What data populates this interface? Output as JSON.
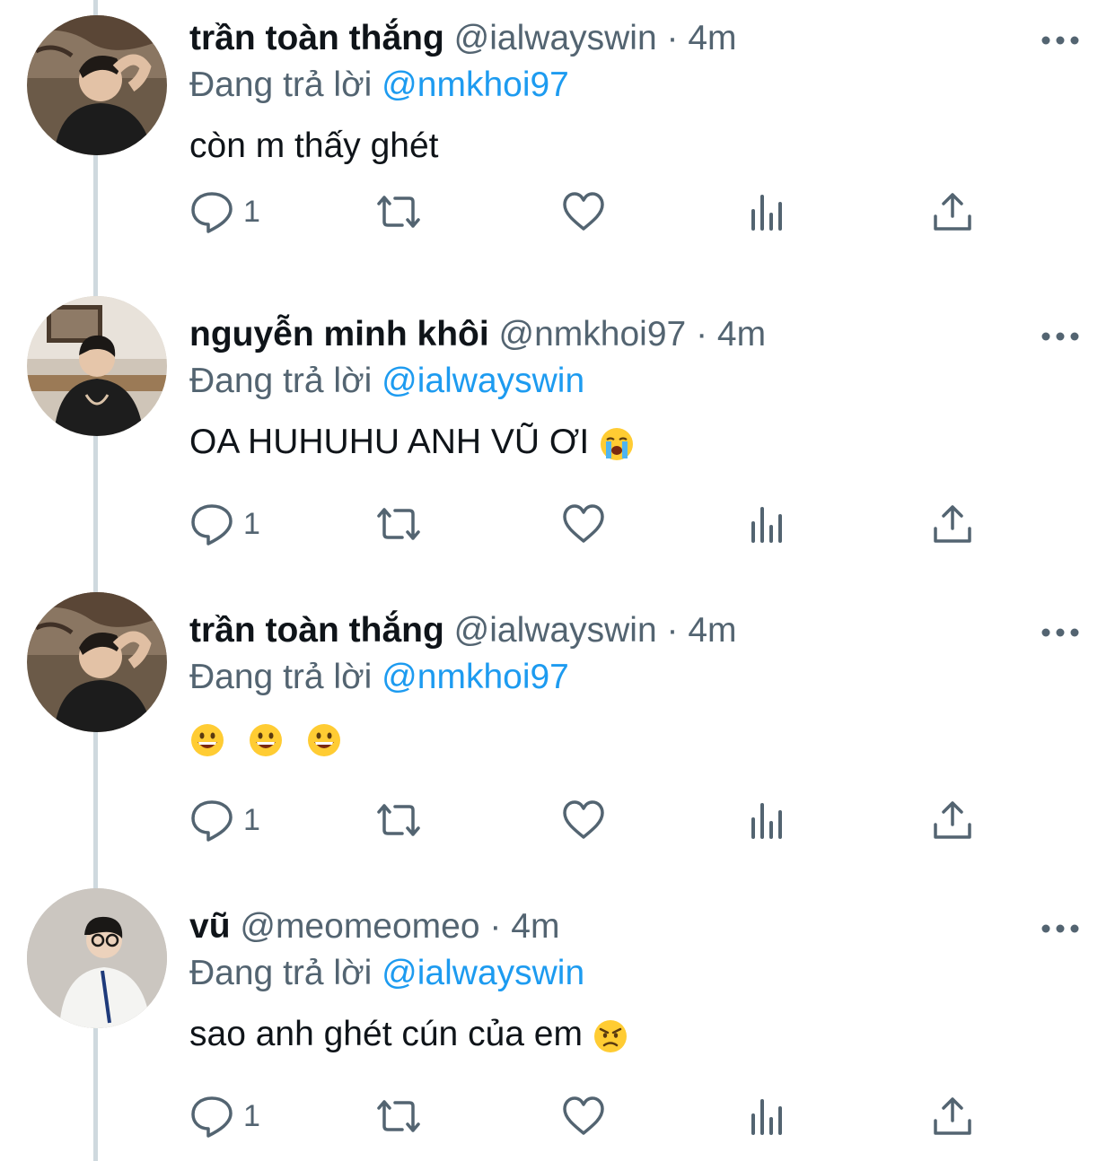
{
  "reply_prefix": "Đang trả lời",
  "tweets": [
    {
      "display_name": "trần toàn thắng",
      "handle": "@ialwayswin",
      "separator": "·",
      "time": "4m",
      "reply_to": "@nmkhoi97",
      "text": "còn m thấy ghét",
      "reply_count": "1",
      "avatar_icon": "avatar-photo-man-hand-on-head"
    },
    {
      "display_name": "nguyễn minh khôi",
      "handle": "@nmkhoi97",
      "separator": "·",
      "time": "4m",
      "reply_to": "@ialwayswin",
      "text": "OA HUHUHU ANH VŨ ƠI",
      "emoji": "loudly-crying-face",
      "reply_count": "1",
      "avatar_icon": "avatar-photo-man-black-shirt"
    },
    {
      "display_name": "trần toàn thắng",
      "handle": "@ialwayswin",
      "separator": "·",
      "time": "4m",
      "reply_to": "@nmkhoi97",
      "text": "",
      "emoji": "grinning-face x3",
      "reply_count": "1",
      "avatar_icon": "avatar-photo-man-hand-on-head"
    },
    {
      "display_name": "vũ",
      "handle": "@meomeomeo",
      "separator": "·",
      "time": "4m",
      "reply_to": "@ialwayswin",
      "text": "sao anh ghét cún của em",
      "emoji": "angry-face",
      "reply_count": "1",
      "avatar_icon": "avatar-photo-man-glasses-white-shirt"
    }
  ],
  "colors": {
    "text_primary": "#0f1419",
    "text_secondary": "#536471",
    "accent": "#1d9bf0",
    "thread_line": "#cfd9de",
    "icon": "#536471"
  }
}
